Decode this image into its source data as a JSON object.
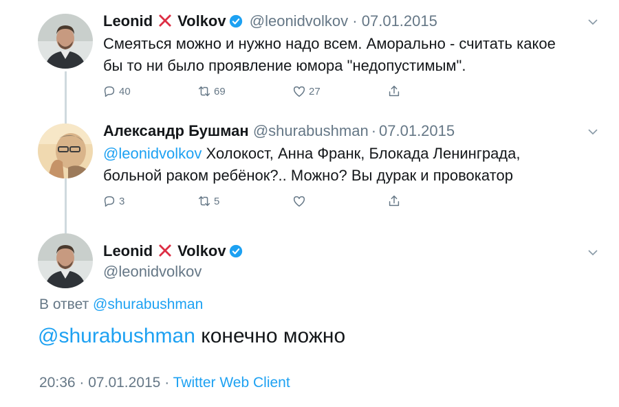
{
  "tweets": [
    {
      "name_first": "Leonid",
      "name_last": "Volkov",
      "handle": "@leonidvolkov",
      "separator": "·",
      "date": "07.01.2015",
      "text": "Смеяться можно и нужно надо всем. Аморально - считать какое бы то ни было проявление юмора \"недопустимым\".",
      "text_line1": "Смеяться можно и нужно надо всем. Аморально - считать какое",
      "text_line2": "бы то ни было проявление юмора \"недопустимым\".",
      "replies": "40",
      "retweets": "69",
      "likes": "27"
    },
    {
      "name": "Александр Бушман",
      "handle": "@shurabushman",
      "separator": "·",
      "date": "07.01.2015",
      "mention": "@leonidvolkov",
      "text_line1_rest": " Холокост, Анна Франк, Блокада Ленинграда,",
      "text_line2": "больной раком ребёнок?.. Можно? Вы дурак и провокатор",
      "replies": "3",
      "retweets": "5",
      "likes": ""
    }
  ],
  "main_tweet": {
    "name_first": "Leonid",
    "name_last": "Volkov",
    "handle": "@leonidvolkov",
    "reply_prefix": "В ответ",
    "reply_to": "@shurabushman",
    "mention": "@shurabushman",
    "text_rest": " конечно можно",
    "time": "20:36",
    "separator": "·",
    "date": "07.01.2015",
    "client": "Twitter Web Client"
  },
  "icons": {
    "verified_color": "#1da1f2",
    "cross_color": "#dd2e44",
    "reply": "reply-icon",
    "retweet": "retweet-icon",
    "like": "heart-icon",
    "share": "share-icon",
    "more": "chevron-down-icon"
  },
  "colors": {
    "link": "#1da1f2",
    "secondary_text": "#657786",
    "thread_line": "#cfd9de"
  }
}
